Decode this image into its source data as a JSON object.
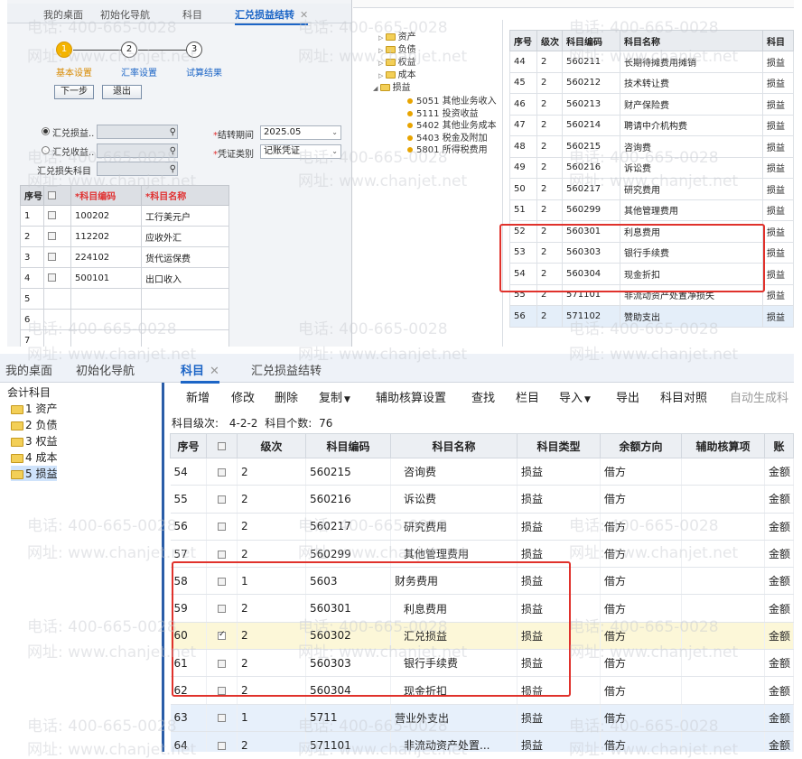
{
  "top_left": {
    "tabs": [
      "我的桌面",
      "初始化导航",
      "科目",
      "汇兑损益结转"
    ],
    "steps": [
      {
        "num": "1",
        "label": "基本设置"
      },
      {
        "num": "2",
        "label": "汇率设置"
      },
      {
        "num": "3",
        "label": "试算结果"
      }
    ],
    "buttons": {
      "next": "下一步",
      "exit": "退出"
    },
    "form": {
      "radio1": "汇兑损益..",
      "radio2": "汇兑收益..",
      "loss_subject": "汇兑损失科目",
      "period_label": "结转期间",
      "period_value": "2025.05",
      "voucher_label": "凭证类别",
      "voucher_value": "记账凭证"
    },
    "table": {
      "headers": [
        "序号",
        "",
        "*科目编码",
        "*科目名称"
      ],
      "rows": [
        [
          "1",
          "100202",
          "工行美元户"
        ],
        [
          "2",
          "112202",
          "应收外汇"
        ],
        [
          "3",
          "224102",
          "货代运保费"
        ],
        [
          "4",
          "500101",
          "出口收入"
        ],
        [
          "5",
          "",
          ""
        ],
        [
          "6",
          "",
          ""
        ],
        [
          "7",
          "",
          ""
        ]
      ]
    }
  },
  "top_right": {
    "tree": {
      "folders": [
        "资产",
        "负债",
        "权益",
        "成本",
        "损益"
      ],
      "leaves": [
        "5051 其他业务收入",
        "5111 投资收益",
        "5402 其他业务成本",
        "5403 税金及附加",
        "5801 所得税费用"
      ]
    },
    "table": {
      "headers": [
        "序号",
        "级次",
        "科目编码",
        "科目名称",
        "科目"
      ],
      "rows": [
        [
          "44",
          "2",
          "560211",
          "长期待摊费用摊销",
          "损益"
        ],
        [
          "45",
          "2",
          "560212",
          "技术转让费",
          "损益"
        ],
        [
          "46",
          "2",
          "560213",
          "财产保险费",
          "损益"
        ],
        [
          "47",
          "2",
          "560214",
          "聘请中介机构费",
          "损益"
        ],
        [
          "48",
          "2",
          "560215",
          "咨询费",
          "损益"
        ],
        [
          "49",
          "2",
          "560216",
          "诉讼费",
          "损益"
        ],
        [
          "50",
          "2",
          "560217",
          "研究费用",
          "损益"
        ],
        [
          "51",
          "2",
          "560299",
          "其他管理费用",
          "损益"
        ],
        [
          "52",
          "2",
          "560301",
          "利息费用",
          "损益"
        ],
        [
          "53",
          "2",
          "560303",
          "银行手续费",
          "损益"
        ],
        [
          "54",
          "2",
          "560304",
          "现金折扣",
          "损益"
        ],
        [
          "55",
          "2",
          "571101",
          "非流动资产处置净损失",
          "损益"
        ],
        [
          "56",
          "2",
          "571102",
          "赞助支出",
          "损益"
        ]
      ]
    }
  },
  "bottom": {
    "tabs": [
      "我的桌面",
      "初始化导航",
      "科目",
      "汇兑损益结转"
    ],
    "tree": {
      "root": "会计科目",
      "items": [
        "1 资产",
        "2 负债",
        "3 权益",
        "4 成本",
        "5 损益"
      ]
    },
    "toolbar": [
      "新增",
      "修改",
      "删除",
      "复制",
      "辅助核算设置",
      "查找",
      "栏目",
      "导入",
      "导出",
      "科目对照",
      "自动生成科"
    ],
    "summary": {
      "level_label": "科目级次:",
      "level_value": "4-2-2",
      "count_label": "科目个数:",
      "count_value": "76"
    },
    "table": {
      "headers": [
        "序号",
        "",
        "级次",
        "科目编码",
        "科目名称",
        "科目类型",
        "余额方向",
        "辅助核算项",
        "账"
      ],
      "rows": [
        [
          "54",
          "2",
          "560215",
          "咨询费",
          "损益",
          "借方",
          "",
          "金额"
        ],
        [
          "55",
          "2",
          "560216",
          "诉讼费",
          "损益",
          "借方",
          "",
          "金额"
        ],
        [
          "56",
          "2",
          "560217",
          "研究费用",
          "损益",
          "借方",
          "",
          "金额"
        ],
        [
          "57",
          "2",
          "560299",
          "其他管理费用",
          "损益",
          "借方",
          "",
          "金额"
        ],
        [
          "58",
          "1",
          "5603",
          "财务费用",
          "损益",
          "借方",
          "",
          "金额"
        ],
        [
          "59",
          "2",
          "560301",
          "利息费用",
          "损益",
          "借方",
          "",
          "金额"
        ],
        [
          "60",
          "2",
          "560302",
          "汇兑损益",
          "损益",
          "借方",
          "",
          "金额"
        ],
        [
          "61",
          "2",
          "560303",
          "银行手续费",
          "损益",
          "借方",
          "",
          "金额"
        ],
        [
          "62",
          "2",
          "560304",
          "现金折扣",
          "损益",
          "借方",
          "",
          "金额"
        ],
        [
          "63",
          "1",
          "5711",
          "营业外支出",
          "损益",
          "借方",
          "",
          "金额"
        ],
        [
          "64",
          "2",
          "571101",
          "非流动资产处置...",
          "损益",
          "借方",
          "",
          "金额"
        ]
      ]
    }
  },
  "watermark": {
    "phone": "电话: 400-665-0028",
    "site": "网址: www.chanjet.net"
  },
  "colors": {
    "accent": "#1c65c6",
    "highlight_border": "#e0322c",
    "selected_row": "#fcf7d8"
  }
}
